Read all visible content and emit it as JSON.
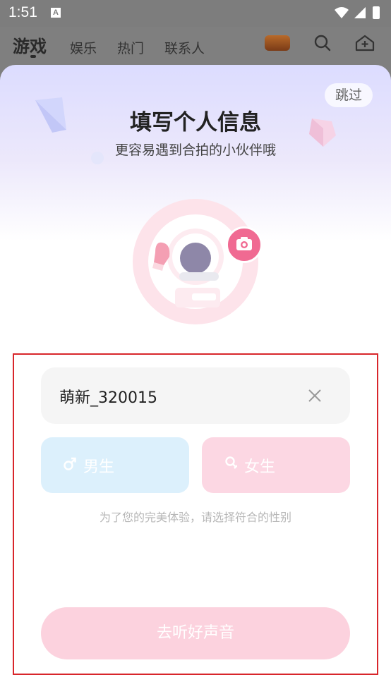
{
  "status_bar": {
    "time": "1:51",
    "notif_glyph": "A"
  },
  "nav": {
    "tabs": [
      {
        "label": "游戏",
        "active": true
      },
      {
        "label": "娱乐",
        "active": false
      },
      {
        "label": "热门",
        "active": false
      },
      {
        "label": "联系人",
        "active": false
      }
    ]
  },
  "sheet": {
    "skip_label": "跳过",
    "title": "填写个人信息",
    "subtitle": "更容易遇到合拍的小伙伴哦",
    "nickname_value": "萌新_320015",
    "gender": {
      "male_label": "男生",
      "female_label": "女生"
    },
    "hint": "为了您的完美体验，请选择符合的性别",
    "submit_label": "去听好声音"
  },
  "colors": {
    "accent_pink": "#f06a92",
    "submit_bg": "#fcd2de",
    "male_bg": "#dcf0fc",
    "female_bg": "#fcd7e3",
    "highlight_border": "#d8262b"
  }
}
